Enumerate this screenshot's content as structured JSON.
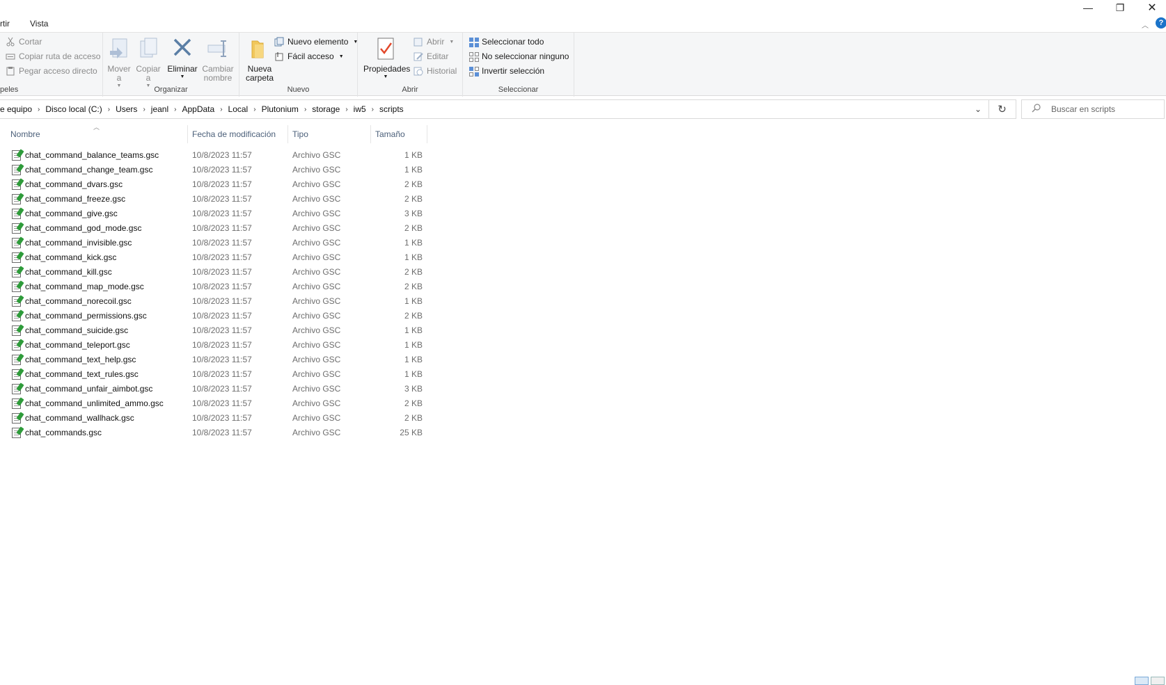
{
  "window": {
    "minimize_glyph": "—",
    "maximize_glyph": "❐",
    "close_glyph": "✕"
  },
  "ribbon_tabs": {
    "share": "rtir",
    "view": "Vista",
    "help_glyph": "?"
  },
  "ribbon": {
    "clipboard": {
      "label": "peles",
      "cut": "Cortar",
      "copy_path": "Copiar ruta de acceso",
      "paste_shortcut": "Pegar acceso directo"
    },
    "organize": {
      "label": "Organizar",
      "move_line1": "Mover",
      "move_line2": "a",
      "copy_line1": "Copiar",
      "copy_line2": "a",
      "delete": "Eliminar",
      "rename_line1": "Cambiar",
      "rename_line2": "nombre"
    },
    "new": {
      "label": "Nuevo",
      "new_folder_line1": "Nueva",
      "new_folder_line2": "carpeta",
      "new_item": "Nuevo elemento",
      "easy_access": "Fácil acceso"
    },
    "open": {
      "label": "Abrir",
      "properties": "Propiedades",
      "open": "Abrir",
      "edit": "Editar",
      "history": "Historial"
    },
    "select": {
      "label": "Seleccionar",
      "select_all": "Seleccionar todo",
      "select_none": "No seleccionar ninguno",
      "invert": "Invertir selección"
    }
  },
  "address": {
    "crumbs": [
      "e equipo",
      "Disco local (C:)",
      "Users",
      "jeanl",
      "AppData",
      "Local",
      "Plutonium",
      "storage",
      "iw5",
      "scripts"
    ]
  },
  "search": {
    "placeholder": "Buscar en scripts"
  },
  "columns": {
    "name": "Nombre",
    "date": "Fecha de modificación",
    "type": "Tipo",
    "size": "Tamaño"
  },
  "files": [
    {
      "name": "chat_command_balance_teams.gsc",
      "date": "10/8/2023 11:57",
      "type": "Archivo GSC",
      "size": "1 KB"
    },
    {
      "name": "chat_command_change_team.gsc",
      "date": "10/8/2023 11:57",
      "type": "Archivo GSC",
      "size": "1 KB"
    },
    {
      "name": "chat_command_dvars.gsc",
      "date": "10/8/2023 11:57",
      "type": "Archivo GSC",
      "size": "2 KB"
    },
    {
      "name": "chat_command_freeze.gsc",
      "date": "10/8/2023 11:57",
      "type": "Archivo GSC",
      "size": "2 KB"
    },
    {
      "name": "chat_command_give.gsc",
      "date": "10/8/2023 11:57",
      "type": "Archivo GSC",
      "size": "3 KB"
    },
    {
      "name": "chat_command_god_mode.gsc",
      "date": "10/8/2023 11:57",
      "type": "Archivo GSC",
      "size": "2 KB"
    },
    {
      "name": "chat_command_invisible.gsc",
      "date": "10/8/2023 11:57",
      "type": "Archivo GSC",
      "size": "1 KB"
    },
    {
      "name": "chat_command_kick.gsc",
      "date": "10/8/2023 11:57",
      "type": "Archivo GSC",
      "size": "1 KB"
    },
    {
      "name": "chat_command_kill.gsc",
      "date": "10/8/2023 11:57",
      "type": "Archivo GSC",
      "size": "2 KB"
    },
    {
      "name": "chat_command_map_mode.gsc",
      "date": "10/8/2023 11:57",
      "type": "Archivo GSC",
      "size": "2 KB"
    },
    {
      "name": "chat_command_norecoil.gsc",
      "date": "10/8/2023 11:57",
      "type": "Archivo GSC",
      "size": "1 KB"
    },
    {
      "name": "chat_command_permissions.gsc",
      "date": "10/8/2023 11:57",
      "type": "Archivo GSC",
      "size": "2 KB"
    },
    {
      "name": "chat_command_suicide.gsc",
      "date": "10/8/2023 11:57",
      "type": "Archivo GSC",
      "size": "1 KB"
    },
    {
      "name": "chat_command_teleport.gsc",
      "date": "10/8/2023 11:57",
      "type": "Archivo GSC",
      "size": "1 KB"
    },
    {
      "name": "chat_command_text_help.gsc",
      "date": "10/8/2023 11:57",
      "type": "Archivo GSC",
      "size": "1 KB"
    },
    {
      "name": "chat_command_text_rules.gsc",
      "date": "10/8/2023 11:57",
      "type": "Archivo GSC",
      "size": "1 KB"
    },
    {
      "name": "chat_command_unfair_aimbot.gsc",
      "date": "10/8/2023 11:57",
      "type": "Archivo GSC",
      "size": "3 KB"
    },
    {
      "name": "chat_command_unlimited_ammo.gsc",
      "date": "10/8/2023 11:57",
      "type": "Archivo GSC",
      "size": "2 KB"
    },
    {
      "name": "chat_command_wallhack.gsc",
      "date": "10/8/2023 11:57",
      "type": "Archivo GSC",
      "size": "2 KB"
    },
    {
      "name": "chat_commands.gsc",
      "date": "10/8/2023 11:57",
      "type": "Archivo GSC",
      "size": "25 KB"
    }
  ],
  "colors": {
    "accent": "#1a73c9",
    "file_icon_green": "#2e9b3a",
    "header_text": "#4c607a"
  }
}
